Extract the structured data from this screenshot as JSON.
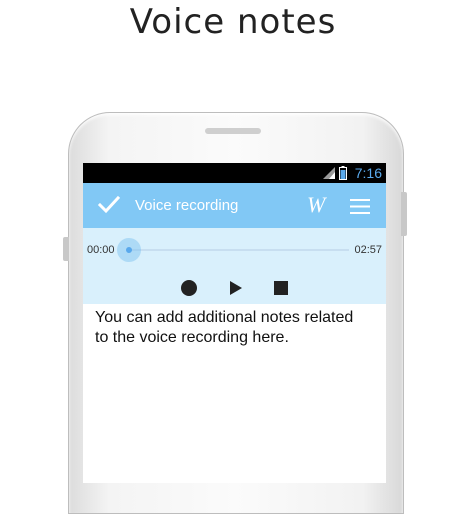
{
  "promo": {
    "title": "Voice notes"
  },
  "status_bar": {
    "time": "7:16",
    "icons": [
      "signal-icon",
      "battery-icon"
    ],
    "time_color": "#5aa9ec"
  },
  "action_bar": {
    "title": "Voice recording",
    "w_label": "W",
    "icons": [
      "check-icon",
      "menu-icon"
    ],
    "background": "#81c8f5"
  },
  "player": {
    "current_time": "00:00",
    "total_time": "02:57",
    "progress": 0,
    "controls": [
      "record-icon",
      "play-icon",
      "stop-icon"
    ],
    "background": "#d9f0fc"
  },
  "notes": {
    "text": "You can add additional notes related\nto the voice recording here."
  }
}
